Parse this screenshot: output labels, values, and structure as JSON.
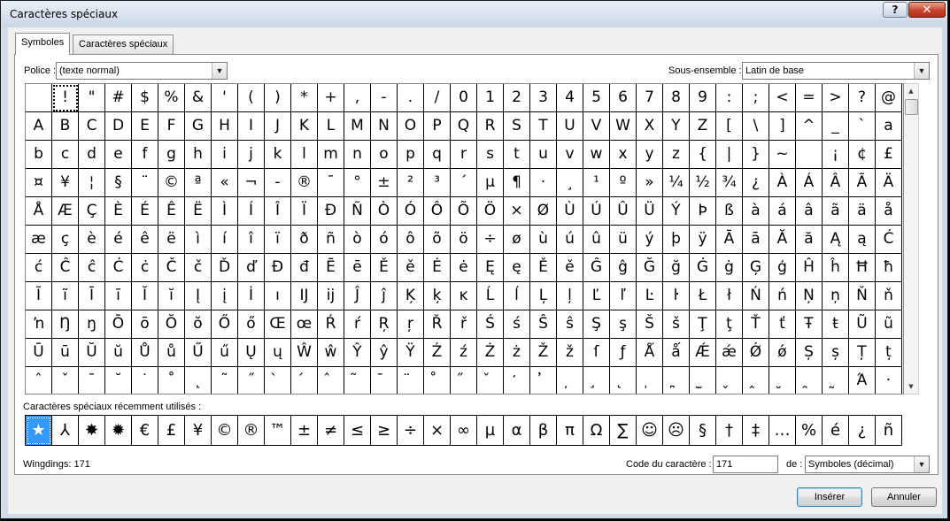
{
  "window": {
    "title": "Caractères spéciaux",
    "help": "?",
    "close": "✕"
  },
  "tabs": [
    {
      "label": "Symboles",
      "active": true
    },
    {
      "label": "Caractères spéciaux",
      "active": false
    }
  ],
  "font": {
    "label": "Police :",
    "value": "(texte normal)"
  },
  "subset": {
    "label": "Sous-ensemble :",
    "value": "Latin de base"
  },
  "grid": {
    "selected_char": "!",
    "chars": [
      " ",
      "!",
      "\"",
      "#",
      "$",
      "%",
      "&",
      "'",
      "(",
      ")",
      "*",
      "+",
      ",",
      "-",
      ".",
      "/",
      "0",
      "1",
      "2",
      "3",
      "4",
      "5",
      "6",
      "7",
      "8",
      "9",
      ":",
      ";",
      "<",
      "=",
      ">",
      "?",
      "@",
      "A",
      "B",
      "C",
      "D",
      "E",
      "F",
      "G",
      "H",
      "I",
      "J",
      "K",
      "L",
      "M",
      "N",
      "O",
      "P",
      "Q",
      "R",
      "S",
      "T",
      "U",
      "V",
      "W",
      "X",
      "Y",
      "Z",
      "[",
      "\\",
      "]",
      "^",
      "_",
      "`",
      "a",
      "b",
      "c",
      "d",
      "e",
      "f",
      "g",
      "h",
      "i",
      "j",
      "k",
      "l",
      "m",
      "n",
      "o",
      "p",
      "q",
      "r",
      "s",
      "t",
      "u",
      "v",
      "w",
      "x",
      "y",
      "z",
      "{",
      "|",
      "}",
      "~",
      " ",
      "¡",
      "¢",
      "£",
      "¤",
      "¥",
      "¦",
      "§",
      "¨",
      "©",
      "ª",
      "«",
      "¬",
      "-",
      "®",
      "¯",
      "°",
      "±",
      "²",
      "³",
      "´",
      "µ",
      "¶",
      "·",
      "¸",
      "¹",
      "º",
      "»",
      "¼",
      "½",
      "¾",
      "¿",
      "À",
      "Á",
      "Â",
      "Ã",
      "Ä",
      "Å",
      "Æ",
      "Ç",
      "È",
      "É",
      "Ê",
      "Ë",
      "Ì",
      "Í",
      "Î",
      "Ï",
      "Ð",
      "Ñ",
      "Ò",
      "Ó",
      "Ô",
      "Õ",
      "Ö",
      "×",
      "Ø",
      "Ù",
      "Ú",
      "Û",
      "Ü",
      "Ý",
      "Þ",
      "ß",
      "à",
      "á",
      "â",
      "ã",
      "ä",
      "å",
      "æ",
      "ç",
      "è",
      "é",
      "ê",
      "ë",
      "ì",
      "í",
      "î",
      "ï",
      "ð",
      "ñ",
      "ò",
      "ó",
      "ô",
      "õ",
      "ö",
      "÷",
      "ø",
      "ù",
      "ú",
      "û",
      "ü",
      "ý",
      "þ",
      "ÿ",
      "Ā",
      "ā",
      "Ă",
      "ă",
      "Ą",
      "ą",
      "Ć",
      "ć",
      "Ĉ",
      "ĉ",
      "Ċ",
      "ċ",
      "Č",
      "č",
      "Ď",
      "ď",
      "Đ",
      "đ",
      "Ē",
      "ē",
      "Ě",
      "ě",
      "Ė",
      "ė",
      "Ę",
      "ę",
      "Ě",
      "ě",
      "Ĝ",
      "ĝ",
      "Ğ",
      "ğ",
      "Ġ",
      "ġ",
      "Ģ",
      "ģ",
      "Ĥ",
      "ĥ",
      "Ħ",
      "ħ",
      "Ĩ",
      "ĩ",
      "Ī",
      "ī",
      "Ĭ",
      "ĭ",
      "Į",
      "į",
      "İ",
      "ı",
      "Ĳ",
      "ĳ",
      "Ĵ",
      "ĵ",
      "Ķ",
      "ķ",
      "ĸ",
      "Ĺ",
      "ĺ",
      "Ļ",
      "ļ",
      "Ľ",
      "ľ",
      "Ŀ",
      "ŀ",
      "Ł",
      "ł",
      "Ń",
      "ń",
      "Ņ",
      "ņ",
      "Ň",
      "ň",
      "ŉ",
      "Ŋ",
      "ŋ",
      "Ō",
      "ō",
      "Ŏ",
      "ŏ",
      "Ő",
      "ő",
      "Œ",
      "œ",
      "Ŕ",
      "ŕ",
      "Ŗ",
      "ŗ",
      "Ř",
      "ř",
      "Ś",
      "ś",
      "Ŝ",
      "ŝ",
      "Ş",
      "ş",
      "Š",
      "š",
      "Ţ",
      "ţ",
      "Ť",
      "ť",
      "Ŧ",
      "ŧ",
      "Ũ",
      "ũ",
      "Ū",
      "ū",
      "Ŭ",
      "ŭ",
      "Ů",
      "ů",
      "Ű",
      "ű",
      "Ų",
      "ų",
      "Ŵ",
      "ŵ",
      "Ŷ",
      "ŷ",
      "Ÿ",
      "Ź",
      "ź",
      "Ż",
      "ż",
      "Ž",
      "ž",
      "ſ",
      "ƒ",
      "Ǻ",
      "ǻ",
      "Ǽ",
      "ǽ",
      "Ǿ",
      "ǿ",
      "Ș",
      "ș",
      "Ț",
      "ț",
      "ˆ",
      "ˇ",
      "ˉ",
      "˘",
      "˙",
      "˚",
      "˛",
      "˜",
      "˝",
      "̀",
      "́",
      "̂",
      "̃",
      "̄",
      "̈",
      "̊",
      "̋",
      "̌",
      "̒",
      "̓",
      "̦",
      "̧",
      "̨",
      "̩",
      "̪",
      "̫",
      "̬",
      "̭",
      "̮",
      "̯",
      "̰",
      "Ά",
      "·"
    ]
  },
  "recent": {
    "label": "Caractères spéciaux récemment utilisés :",
    "chars": [
      "★",
      "⅄",
      "✸",
      "✹",
      "€",
      "£",
      "¥",
      "©",
      "®",
      "™",
      "±",
      "≠",
      "≤",
      "≥",
      "÷",
      "×",
      "∞",
      "µ",
      "α",
      "β",
      "π",
      "Ω",
      "∑",
      "☺",
      "☹",
      "§",
      "†",
      "‡",
      "…",
      "%",
      "é",
      "¿",
      "ñ"
    ]
  },
  "status": {
    "font_info": "Wingdings: 171"
  },
  "code": {
    "label": "Code du caractère :",
    "value": "171"
  },
  "from": {
    "label": "de :",
    "value": "Symboles (décimal)"
  },
  "buttons": {
    "insert": "Insérer",
    "cancel": "Annuler"
  }
}
